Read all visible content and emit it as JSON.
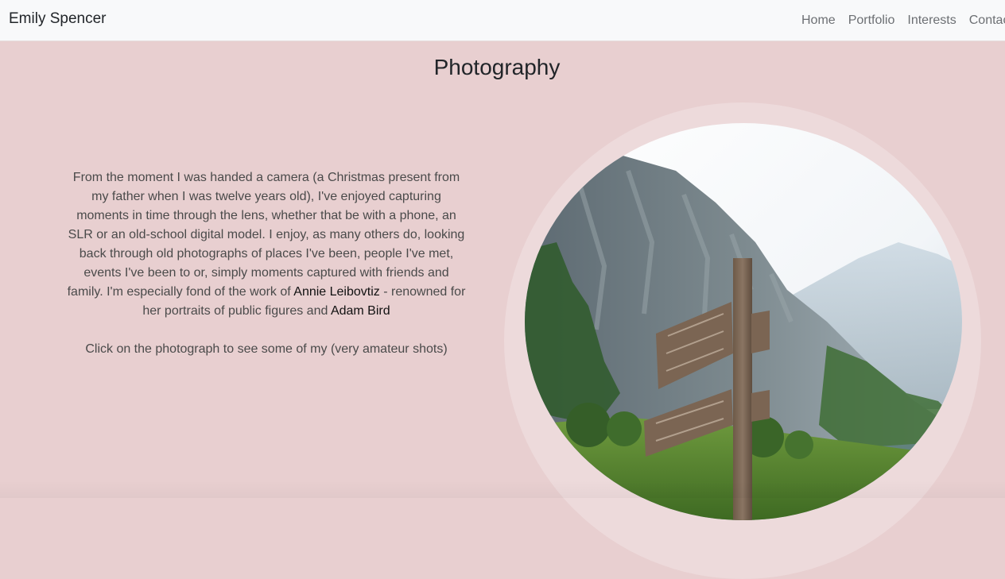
{
  "navbar": {
    "brand": "Emily Spencer",
    "links": [
      "Home",
      "Portfolio",
      "Interests",
      "Contac"
    ]
  },
  "main": {
    "title": "Photography",
    "bio": {
      "text_before_link1": "From the moment I was handed a camera (a Christmas present from my father when I was twelve years old), I've enjoyed capturing moments in time through the lens, whether that be with a phone, an SLR or an old-school digital model. I enjoy, as many others do, looking back through old photographs of places I've been, people I've met, events I've been to or, simply moments captured with friends and family. I'm especially fond of the work of ",
      "link1": "Annie Leibovtiz",
      "text_between_links": " - renowned for her portraits of public figures and ",
      "link2": "Adam Bird",
      "cta": "Click on the photograph to see some of my (very amateur shots)"
    },
    "photo_alt_icon": "mountain-signpost-photo"
  },
  "colors": {
    "background": "#e8cfd0",
    "navbar_bg": "#f8f9fa",
    "ring": "#eddadb"
  }
}
